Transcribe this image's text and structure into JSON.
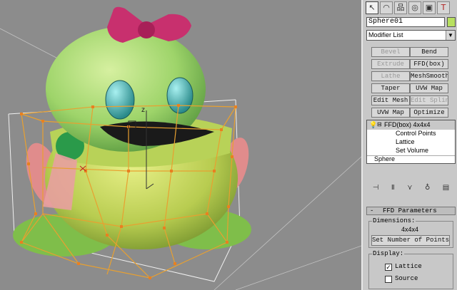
{
  "viewport": {
    "axis_label": "z",
    "colors": {
      "bg": "#8c8c8c",
      "body": "#b8dc7a",
      "bow": "#c8306e",
      "scarf": "#b0cc50",
      "lattice": "#e8a030"
    }
  },
  "panel": {
    "tabs": [
      {
        "icon": "create-icon",
        "glyph": "↖",
        "active": true
      },
      {
        "icon": "modify-icon",
        "glyph": "◠"
      },
      {
        "icon": "hierarchy-icon",
        "glyph": "品"
      },
      {
        "icon": "motion-icon",
        "glyph": "◎"
      },
      {
        "icon": "display-icon",
        "glyph": "▣"
      },
      {
        "icon": "utilities-icon",
        "glyph": "T"
      }
    ],
    "object_name": "Sphere01",
    "modifier_list_label": "Modifier List",
    "modifier_buttons": [
      {
        "label": "Bevel",
        "disabled": true
      },
      {
        "label": "Bend",
        "disabled": false
      },
      {
        "label": "Extrude",
        "disabled": true
      },
      {
        "label": "FFD(box)",
        "disabled": false
      },
      {
        "label": "Lathe",
        "disabled": true
      },
      {
        "label": "MeshSmooth",
        "disabled": false
      },
      {
        "label": "Taper",
        "disabled": false
      },
      {
        "label": "UVW Map",
        "disabled": false
      },
      {
        "label": "Edit Mesh",
        "disabled": false
      },
      {
        "label": "Edit Spline",
        "disabled": true
      },
      {
        "label": "UVW Map",
        "disabled": false
      },
      {
        "label": "Optimize",
        "disabled": false
      }
    ],
    "stack": {
      "ffd_label": "FFD(box) 4x4x4",
      "sub_items": [
        "Control Points",
        "Lattice",
        "Set Volume"
      ],
      "base_label": "Sphere"
    },
    "stack_toolbar": [
      "pin-stack-icon",
      "show-end-result-icon",
      "make-unique-icon",
      "remove-modifier-icon",
      "configure-sets-icon"
    ],
    "ffd_parameters": {
      "title": "FFD Parameters",
      "dimensions_label": "Dimensions:",
      "dimensions_value": "4x4x4",
      "set_points_button": "Set Number of Points",
      "display_label": "Display:",
      "lattice_label": "Lattice",
      "lattice_checked": true,
      "source_label": "Source",
      "source_checked": false
    }
  }
}
